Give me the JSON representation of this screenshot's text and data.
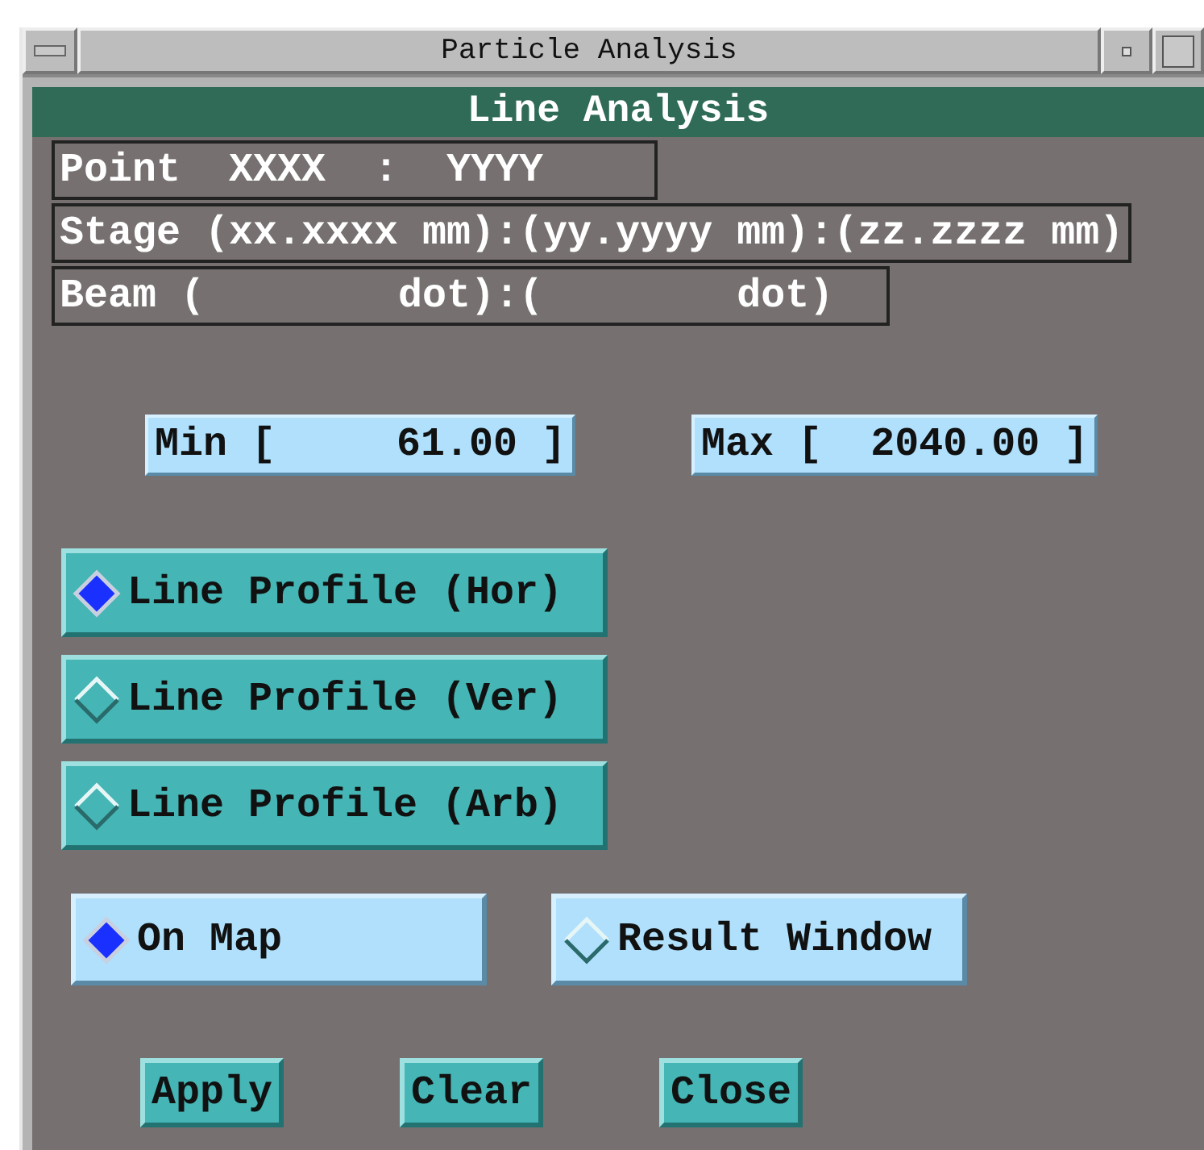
{
  "window": {
    "title": "Particle  Analysis"
  },
  "header": "Line Analysis",
  "info_rows": [
    {
      "text": "Point  XXXX  :  YYYY"
    },
    {
      "text": "Stage (xx.xxxx mm):(yy.yyyy mm):(zz.zzzz mm)"
    },
    {
      "text": "Beam (        dot):(        dot)"
    }
  ],
  "range_fields": [
    {
      "text": "Min [     61.00 ]"
    },
    {
      "text": "Max [  2040.00 ]"
    }
  ],
  "profile_options": [
    {
      "label": "Line Profile (Hor)",
      "selected": true
    },
    {
      "label": "Line Profile (Ver)",
      "selected": false
    },
    {
      "label": "Line Profile (Arb)",
      "selected": false
    }
  ],
  "output_options": [
    {
      "label": "On Map",
      "selected": true
    },
    {
      "label": "Result Window",
      "selected": false
    }
  ],
  "buttons": [
    "Apply",
    "Clear",
    "Close"
  ]
}
